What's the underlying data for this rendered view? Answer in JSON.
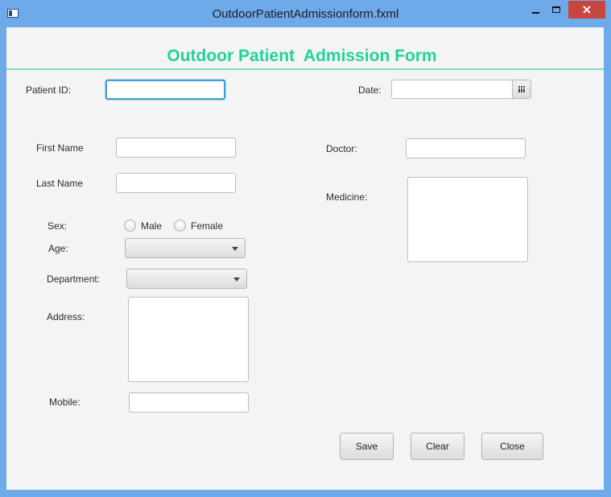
{
  "window": {
    "title": "OutdoorPatientAdmissionform.fxml",
    "close_glyph": "×",
    "icons": [
      "app-icon",
      "minimize-icon",
      "maximize-icon",
      "close-icon"
    ]
  },
  "form": {
    "heading": "Outdoor Patient  Admission Form",
    "heading_color": "#21d39a",
    "accent_color": "#3e9fd8",
    "patient_id_label": "Patient ID:",
    "patient_id_value": "",
    "date_label": "Date:",
    "date_value": "",
    "first_name_label": "First Name",
    "first_name_value": "",
    "last_name_label": "Last Name",
    "last_name_value": "",
    "sex_label": "Sex:",
    "sex_options": [
      "Male",
      "Female"
    ],
    "age_label": "Age:",
    "age_value": "",
    "department_label": "Department:",
    "department_value": "",
    "address_label": "Address:",
    "address_value": "",
    "mobile_label": "Mobile:",
    "mobile_value": "",
    "doctor_label": "Doctor:",
    "doctor_value": "",
    "medicine_label": "Medicine:",
    "medicine_value": ""
  },
  "actions": {
    "save": "Save",
    "clear": "Clear",
    "close": "Close"
  }
}
